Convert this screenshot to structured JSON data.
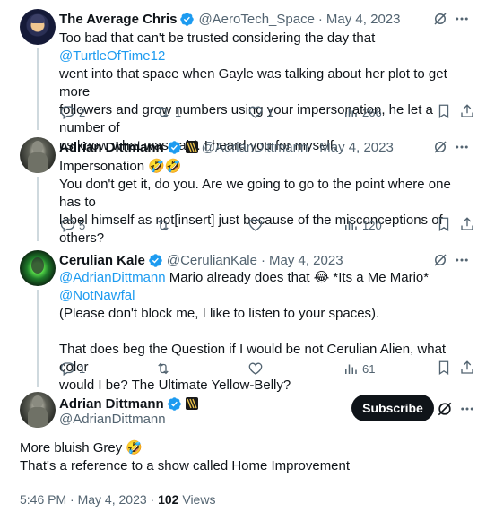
{
  "tweets": [
    {
      "name": "The Average Chris",
      "handle": "@AeroTech_Space",
      "sep": "·",
      "date": "May 4, 2023",
      "text_lines": [
        [
          "Too bad that can't be trusted considering the day that ",
          "@TurtleOfTime12",
          ""
        ],
        [
          "went into that space when Gayle was talking about her plot to get more",
          "",
          ""
        ],
        [
          "followers and grow numbers using your impersonation, he let a number of",
          "",
          ""
        ],
        [
          "us know what was said. I heard you for myself.",
          "",
          ""
        ]
      ],
      "replies": "2",
      "retweets": "1",
      "likes": "1",
      "views": "266"
    },
    {
      "name": "Adrian Dittmann",
      "handle": "@AdrianDittmann",
      "sep": "·",
      "date": "May 4, 2023",
      "line1": "Impersonation 🤣🤣",
      "line2": "You don't get it, do you. Are we going to go to the point where one has to",
      "line3": "label himself as not[insert] just because of the misconceptions of others?",
      "replies": "5",
      "retweets": "",
      "likes": "",
      "views": "120"
    },
    {
      "name": "Cerulian Kale",
      "handle": "@CerulianKale",
      "sep": "·",
      "date": "May 4, 2023",
      "mention1": "@AdrianDittmann",
      "mid_text": " Mario already does that 😂 *Its a Me Mario* ",
      "mention2": "@NotNawfal",
      "line2": "(Please don't block me, I like to listen to your spaces).",
      "line3": "That does beg the Question if I would be not Cerulian Alien, what color",
      "line4": "would I be? The Ultimate Yellow-Belly?",
      "replies": "1",
      "retweets": "",
      "likes": "",
      "views": "61"
    }
  ],
  "main": {
    "name": "Adrian Dittmann",
    "handle": "@AdrianDittmann",
    "subscribe_label": "Subscribe",
    "line1": "More bluish Grey 🤣",
    "line2": "That's a reference to a show called Home Improvement",
    "time": "5:46 PM",
    "sep": "·",
    "date": "May 4, 2023",
    "dot": "·",
    "views_count": "102",
    "views_label": "Views"
  },
  "colors": {
    "accent": "#1d9bf0",
    "text": "#0f1419",
    "muted": "#536471",
    "thread_line": "#cfd9de",
    "verified": "#1d9bf0"
  }
}
